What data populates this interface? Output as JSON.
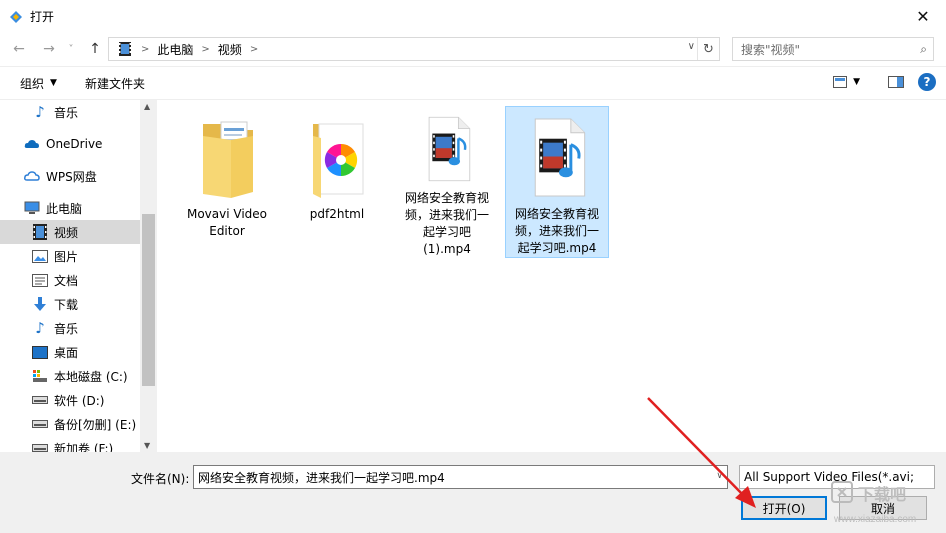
{
  "window": {
    "title": "打开",
    "close": "✕"
  },
  "nav": {
    "back": "←",
    "forward": "→",
    "recent": "˅",
    "up": "↑",
    "breadcrumb": [
      "此电脑",
      "视频"
    ],
    "search_placeholder": "搜索\"视频\""
  },
  "toolbar": {
    "organize": "组织",
    "new_folder": "新建文件夹"
  },
  "sidebar": {
    "items": [
      {
        "label": "音乐",
        "icon": "music-icon"
      },
      {
        "label": "OneDrive",
        "icon": "cloud-icon"
      },
      {
        "label": "WPS网盘",
        "icon": "wps-cloud-icon"
      },
      {
        "label": "此电脑",
        "icon": "computer-icon"
      },
      {
        "label": "视频",
        "icon": "video-folder-icon"
      },
      {
        "label": "图片",
        "icon": "pictures-folder-icon"
      },
      {
        "label": "文档",
        "icon": "documents-folder-icon"
      },
      {
        "label": "下载",
        "icon": "download-icon"
      },
      {
        "label": "音乐",
        "icon": "music-icon"
      },
      {
        "label": "桌面",
        "icon": "desktop-icon"
      },
      {
        "label": "本地磁盘 (C:)",
        "icon": "system-drive-icon"
      },
      {
        "label": "软件 (D:)",
        "icon": "drive-icon"
      },
      {
        "label": "备份[勿删] (E:)",
        "icon": "drive-icon"
      },
      {
        "label": "新加卷 (F:)",
        "icon": "drive-icon"
      }
    ]
  },
  "files": [
    {
      "name": "Movavi Video Editor",
      "lines": [
        "Movavi Video",
        "Editor"
      ],
      "type": "folder"
    },
    {
      "name": "pdf2html",
      "lines": [
        "pdf2html"
      ],
      "type": "folder"
    },
    {
      "name": "网络安全教育视频，进来我们一起学习吧(1).mp4",
      "lines": [
        "网络安全教育视",
        "频，进来我们一",
        "起学习吧",
        "(1).mp4"
      ],
      "type": "video"
    },
    {
      "name": "网络安全教育视频，进来我们一起学习吧.mp4",
      "lines": [
        "网络安全教育视",
        "频，进来我们一",
        "起学习吧.mp4"
      ],
      "type": "video",
      "selected": true
    }
  ],
  "bottom": {
    "filename_label": "文件名(N):",
    "filename_value": "网络安全教育视频，进来我们一起学习吧.mp4",
    "filter": "All Support Video Files(*.avi;",
    "open_button": "打开(O)",
    "cancel_button": "取消"
  },
  "watermark": {
    "line1": "下载吧",
    "line2": "www.xiazaiba.com"
  },
  "colors": {
    "accent": "#0078d7",
    "selected_bg": "#cce8ff",
    "arrow": "#e02020",
    "folder": "#f7d774"
  }
}
